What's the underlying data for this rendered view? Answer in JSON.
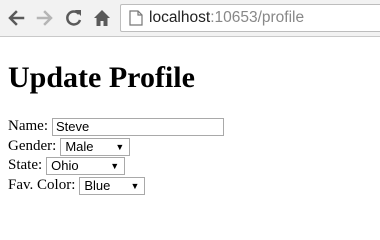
{
  "browser": {
    "url_host": "localhost",
    "url_rest": ":10653/profile"
  },
  "page": {
    "title": "Update Profile",
    "form": {
      "name_label": "Name:",
      "name_value": "Steve",
      "gender_label": "Gender:",
      "gender_value": "Male",
      "state_label": "State:",
      "state_value": "Ohio",
      "color_label": "Fav. Color:",
      "color_value": "Blue"
    }
  },
  "icons": {
    "back": "arrow-left-icon",
    "forward": "arrow-right-icon",
    "reload": "reload-icon",
    "home": "home-icon",
    "page": "page-icon",
    "dropdown": "chevron-down-icon"
  },
  "colors": {
    "toolbar": "#f2f2f2",
    "icon": "#5a5a5a",
    "icon_disabled": "#b5b5b5"
  }
}
